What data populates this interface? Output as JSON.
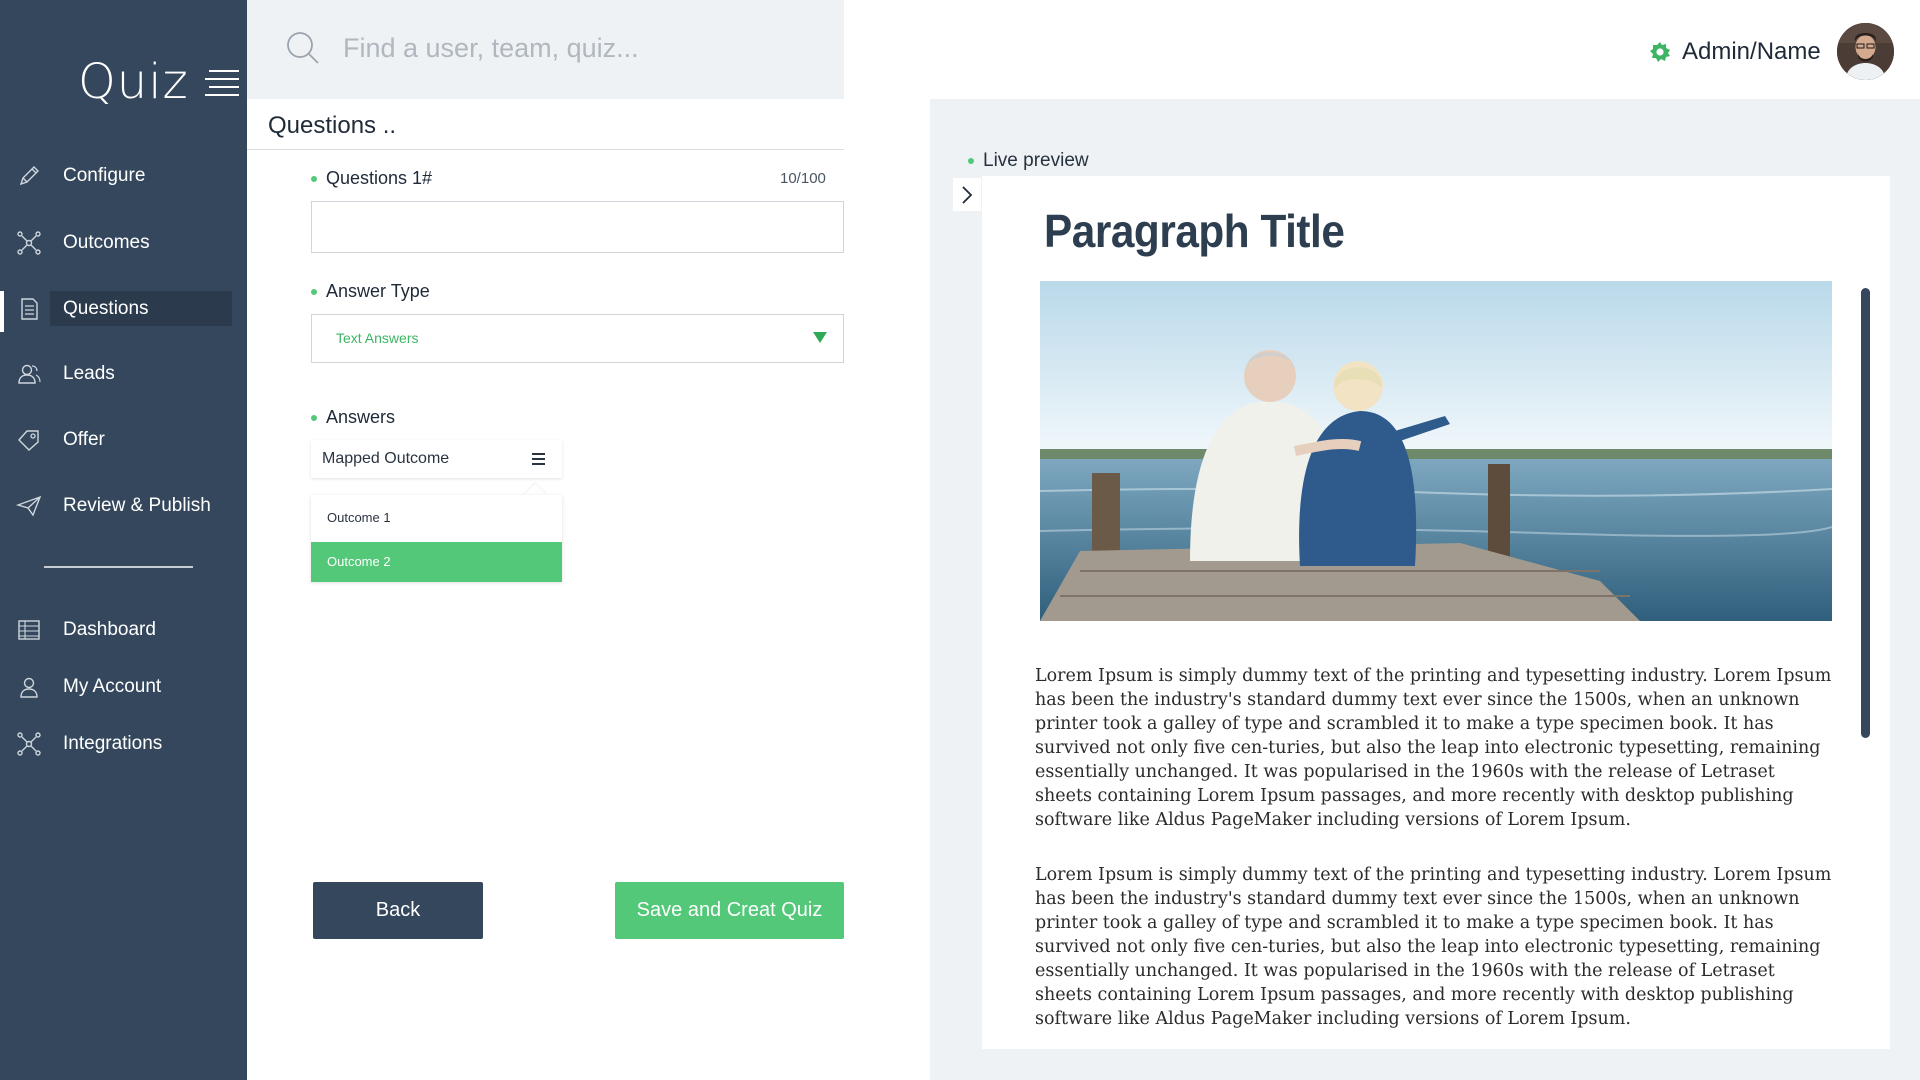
{
  "app": {
    "logo": "Quiz"
  },
  "sidebar": {
    "items": [
      {
        "label": "Configure",
        "icon": "pencil-icon"
      },
      {
        "label": "Outcomes",
        "icon": "network-icon"
      },
      {
        "label": "Questions",
        "icon": "document-icon",
        "active": true
      },
      {
        "label": "Leads",
        "icon": "users-icon"
      },
      {
        "label": "Offer",
        "icon": "tag-icon"
      },
      {
        "label": "Review & Publish",
        "icon": "paper-plane-icon"
      }
    ],
    "secondary_items": [
      {
        "label": "Dashboard",
        "icon": "dashboard-icon"
      },
      {
        "label": "My Account",
        "icon": "user-icon"
      },
      {
        "label": "Integrations",
        "icon": "network-icon"
      }
    ]
  },
  "search": {
    "placeholder": "Find a user, team, quiz...",
    "value": ""
  },
  "header": {
    "user_name": "Admin/Name"
  },
  "form": {
    "panel_title": "Questions ..",
    "question_label": "Questions 1#",
    "question_counter": "10/100",
    "question_value": "",
    "answer_type_label": "Answer Type",
    "answer_type_value": "Text Answers",
    "answers_label": "Answers",
    "mapped_outcome_label": "Mapped Outcome",
    "outcome_options": [
      {
        "label": "Outcome 1",
        "selected": false
      },
      {
        "label": "Outcome 2",
        "selected": true
      }
    ],
    "back_label": "Back",
    "save_label": "Save and Creat Quiz"
  },
  "preview": {
    "label": "Live preview",
    "title": "Paragraph Title",
    "paragraphs": [
      "Lorem Ipsum is simply dummy text of the printing and typesetting industry. Lorem Ipsum has been the industry's standard dummy text ever since the 1500s, when an unknown printer took a galley of type and scrambled it to make a type specimen book. It has survived not only five cen-turies, but also the leap into electronic typesetting, remaining essentially unchanged. It was popularised in the 1960s with the release of Letraset sheets containing Lorem Ipsum passages, and more recently with desktop publishing software like Aldus PageMaker including versions of Lorem Ipsum.",
      "Lorem Ipsum is simply dummy text of the printing and typesetting industry. Lorem Ipsum has been the industry's standard dummy text ever since the 1500s, when an unknown printer took a galley of type and scrambled it to make a type specimen book. It has survived not only five cen-turies, but also the leap into electronic typesetting, remaining essentially unchanged. It was popularised in the 1960s with the release of Letraset sheets containing Lorem Ipsum passages, and more recently with desktop publishing software like Aldus PageMaker including versions of Lorem Ipsum."
    ]
  },
  "colors": {
    "sidebar_bg": "#34475c",
    "accent_green": "#52c878",
    "panel_bg": "#eff2f5"
  }
}
